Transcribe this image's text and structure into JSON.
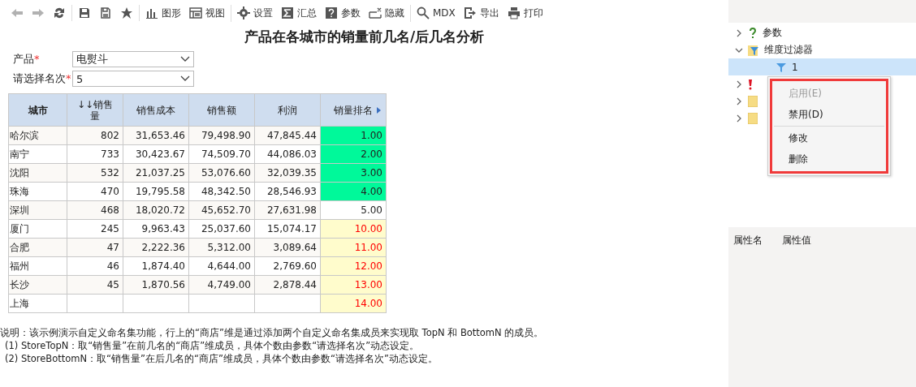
{
  "toolbar": {
    "groups": [
      [
        {
          "disabled": true
        },
        {
          "disabled": true
        },
        {
          "disabled": false
        }
      ],
      [
        {
          "disabled": false
        },
        {
          "disabled": false
        },
        {
          "disabled": false
        }
      ],
      [
        {
          "label": "图形",
          "disabled": false
        },
        {
          "label": "视图",
          "disabled": false
        }
      ],
      [
        {
          "label": "设置",
          "disabled": false
        },
        {
          "label": "汇总",
          "disabled": false
        },
        {
          "label": "参数",
          "disabled": false
        },
        {
          "label": "隐藏",
          "disabled": false
        }
      ],
      [
        {
          "label": "MDX",
          "disabled": false
        },
        {
          "label": "导出",
          "disabled": false
        },
        {
          "label": "打印",
          "disabled": false
        }
      ]
    ]
  },
  "report": {
    "title": "产品在各城市的销量前几名/后几名分析",
    "params": [
      {
        "label": "产品",
        "required_mark": "*",
        "value": "电熨斗"
      },
      {
        "label": "请选择名次",
        "required_mark": "*",
        "value": "5"
      }
    ],
    "columns": [
      "城市",
      "↓↓销售量",
      "销售成本",
      "销售额",
      "利润",
      "销量排名"
    ],
    "rows": [
      {
        "cells": [
          "哈尔滨",
          "802",
          "31,653.46",
          "79,498.90",
          "47,845.44"
        ],
        "rank": "1.00",
        "kind": "top"
      },
      {
        "cells": [
          "南宁",
          "733",
          "30,423.67",
          "74,509.70",
          "44,086.03"
        ],
        "rank": "2.00",
        "kind": "top"
      },
      {
        "cells": [
          "沈阳",
          "532",
          "21,037.25",
          "53,076.60",
          "32,039.35"
        ],
        "rank": "3.00",
        "kind": "top"
      },
      {
        "cells": [
          "珠海",
          "470",
          "19,795.58",
          "48,342.50",
          "28,546.93"
        ],
        "rank": "4.00",
        "kind": "top"
      },
      {
        "cells": [
          "深圳",
          "468",
          "18,020.72",
          "45,652.70",
          "27,631.98"
        ],
        "rank": "5.00",
        "kind": "plain"
      },
      {
        "cells": [
          "厦门",
          "245",
          "9,963.43",
          "25,037.60",
          "15,074.17"
        ],
        "rank": "10.00",
        "kind": "bottom"
      },
      {
        "cells": [
          "合肥",
          "47",
          "2,222.36",
          "5,312.00",
          "3,089.64"
        ],
        "rank": "11.00",
        "kind": "bottom"
      },
      {
        "cells": [
          "福州",
          "46",
          "1,874.40",
          "4,644.00",
          "2,769.60"
        ],
        "rank": "12.00",
        "kind": "bottom"
      },
      {
        "cells": [
          "长沙",
          "45",
          "1,870.56",
          "4,749.00",
          "2,878.44"
        ],
        "rank": "13.00",
        "kind": "bottom"
      },
      {
        "cells": [
          "上海",
          "",
          "",
          "",
          ""
        ],
        "rank": "14.00",
        "kind": "bottom"
      }
    ],
    "notes": [
      "说明：该示例演示自定义命名集功能，行上的“商店”维是通过添加两个自定义命名集成员来实现取 TopN 和 BottomN 的成员。",
      "(1) StoreTopN：取“销售量”在前几名的“商店”维成员，具体个数由参数“请选择名次”动态设定。",
      "(2) StoreBottomN：取“销售量”在后几名的“商店”维成员，具体个数由参数“请选择名次”动态设定。"
    ]
  },
  "tree": [
    {
      "label": "参数",
      "kind": "param",
      "expanded": false,
      "selected": false
    },
    {
      "label": "维度过滤器",
      "kind": "filter",
      "expanded": true,
      "selected": false,
      "children": [
        {
          "label": "1",
          "kind": "filteritem",
          "expanded": false,
          "selected": true
        }
      ]
    },
    {
      "kind": "alert",
      "expanded": false,
      "selected": false
    },
    {
      "kind": "folder",
      "expanded": false,
      "selected": false
    },
    {
      "kind": "folder",
      "expanded": false,
      "selected": false
    }
  ],
  "context_menu": {
    "groups": [
      [
        {
          "label": "启用(E)",
          "disabled": true
        },
        {
          "label": "禁用(D)",
          "disabled": false
        }
      ],
      [
        {
          "label": "修改",
          "disabled": false
        },
        {
          "label": "删除",
          "disabled": false
        }
      ]
    ]
  },
  "properties": {
    "columns": [
      "属性名",
      "属性值"
    ]
  }
}
